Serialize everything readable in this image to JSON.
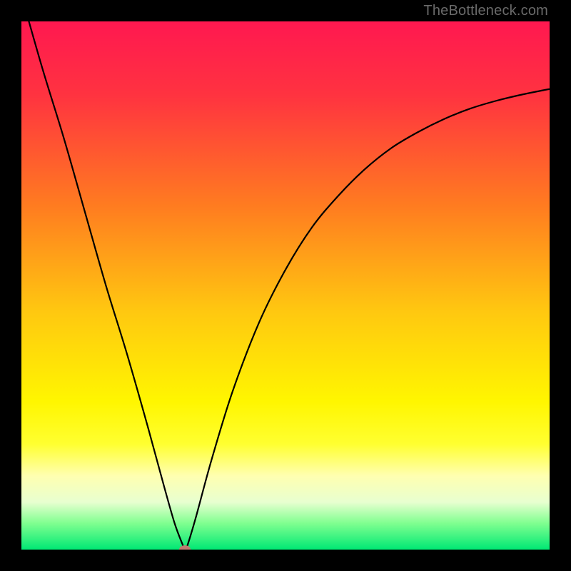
{
  "watermark": "TheBottleneck.com",
  "chart_data": {
    "type": "line",
    "title": "",
    "xlabel": "",
    "ylabel": "",
    "xlim": [
      0,
      100
    ],
    "ylim": [
      0,
      100
    ],
    "grid": false,
    "series": [
      {
        "name": "curve",
        "x": [
          0,
          4,
          8,
          12,
          16,
          20,
          24,
          27,
          29,
          30.5,
          31,
          31.5,
          33,
          36,
          40,
          45,
          50,
          55,
          60,
          65,
          70,
          75,
          80,
          85,
          90,
          95,
          100
        ],
        "y": [
          105,
          91,
          78,
          64,
          50,
          37,
          23,
          12,
          5,
          1,
          0,
          1,
          6,
          17,
          30,
          43,
          53,
          61,
          67,
          72,
          76,
          79,
          81.5,
          83.5,
          85,
          86.2,
          87.2
        ]
      }
    ],
    "annotations": [
      {
        "name": "min-marker",
        "x": 31,
        "y": 0,
        "color": "#c07a70"
      }
    ],
    "background_gradient": {
      "stops": [
        {
          "offset": 0,
          "color": "#ff1850"
        },
        {
          "offset": 14,
          "color": "#ff3340"
        },
        {
          "offset": 35,
          "color": "#ff7c20"
        },
        {
          "offset": 55,
          "color": "#ffc810"
        },
        {
          "offset": 72,
          "color": "#fff600"
        },
        {
          "offset": 80,
          "color": "#ffff30"
        },
        {
          "offset": 86,
          "color": "#ffffb0"
        },
        {
          "offset": 91,
          "color": "#e8ffd0"
        },
        {
          "offset": 95,
          "color": "#80ff90"
        },
        {
          "offset": 100,
          "color": "#00e874"
        }
      ]
    }
  }
}
